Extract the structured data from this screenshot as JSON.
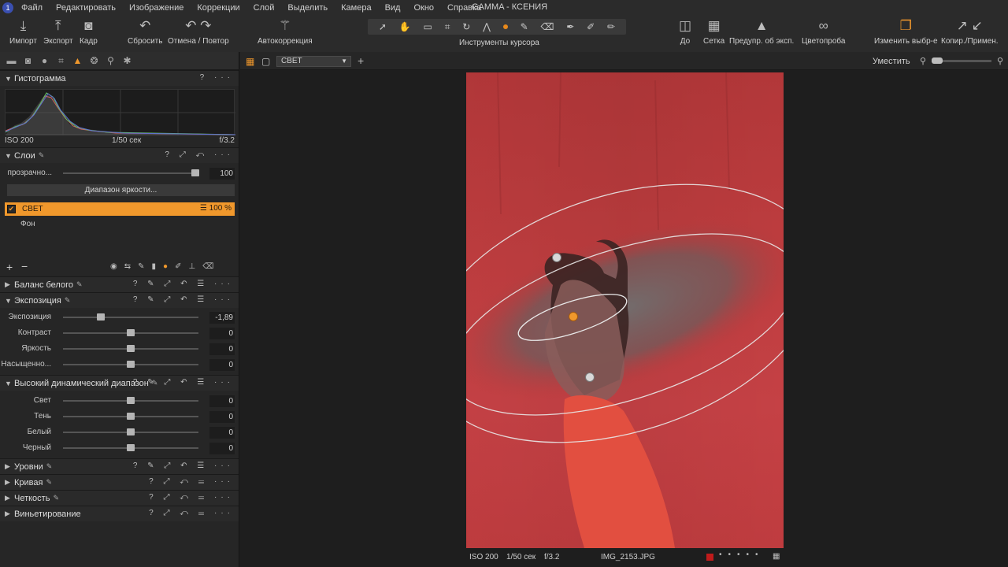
{
  "app": {
    "window_title": "GAMMA - КСЕНИЯ",
    "logo": "1"
  },
  "menu": [
    "Файл",
    "Редактировать",
    "Изображение",
    "Коррекции",
    "Слой",
    "Выделить",
    "Камера",
    "Вид",
    "Окно",
    "Справка"
  ],
  "toolbar": {
    "import": "Импорт",
    "export": "Экспорт",
    "crop": "Кадр",
    "reset": "Сбросить",
    "undo_redo": "Отмена / Повтор",
    "autocorrect": "Автокоррекция",
    "cursor_tools": "Инструменты курсора",
    "before": "До",
    "grid": "Сетка",
    "exposure_warning": "Предупр. об эксп.",
    "color_sample": "Цветопроба",
    "edit_selected": "Изменить выбр-е",
    "copy_apply": "Копир./Примен."
  },
  "viewer": {
    "variant": "СВЕТ",
    "fit": "Уместить"
  },
  "histogram": {
    "title": "Гистограмма",
    "iso": "ISO 200",
    "shutter": "1/50 сек",
    "aperture": "f/3.2"
  },
  "layers": {
    "title": "Слои",
    "opacity_label": "прозрачно...",
    "opacity_value": "100",
    "opacity_level": 1.0,
    "range_button": "Диапазон яркости...",
    "items": [
      {
        "name": "СВЕТ",
        "opacity": "100 %",
        "selected": true
      },
      {
        "name": "Фон",
        "selected": false
      }
    ]
  },
  "white_balance": {
    "title": "Баланс белого"
  },
  "exposure": {
    "title": "Экспозиция",
    "sliders": [
      {
        "label": "Экспозиция",
        "value": "-1,89",
        "level": 0.28
      },
      {
        "label": "Контраст",
        "value": "0",
        "level": 0.5
      },
      {
        "label": "Яркость",
        "value": "0",
        "level": 0.5
      },
      {
        "label": "Насыщенно...",
        "value": "0",
        "level": 0.5
      }
    ]
  },
  "hdr": {
    "title": "Высокий динамический диапазон",
    "sliders": [
      {
        "label": "Свет",
        "value": "0",
        "level": 0.5
      },
      {
        "label": "Тень",
        "value": "0",
        "level": 0.5
      },
      {
        "label": "Белый",
        "value": "0",
        "level": 0.5
      },
      {
        "label": "Черный",
        "value": "0",
        "level": 0.5
      }
    ]
  },
  "levels": {
    "title": "Уровни"
  },
  "curve": {
    "title": "Кривая"
  },
  "clarity": {
    "title": "Четкость"
  },
  "vignetting": {
    "title": "Виньетирование"
  },
  "status": {
    "iso": "ISO 200",
    "shutter": "1/50 сек",
    "aperture": "f/3.2",
    "filename": "IMG_2153.JPG"
  },
  "colors": {
    "accent": "#f0982c",
    "panel": "#262626",
    "photo_red": "#c13e40"
  }
}
